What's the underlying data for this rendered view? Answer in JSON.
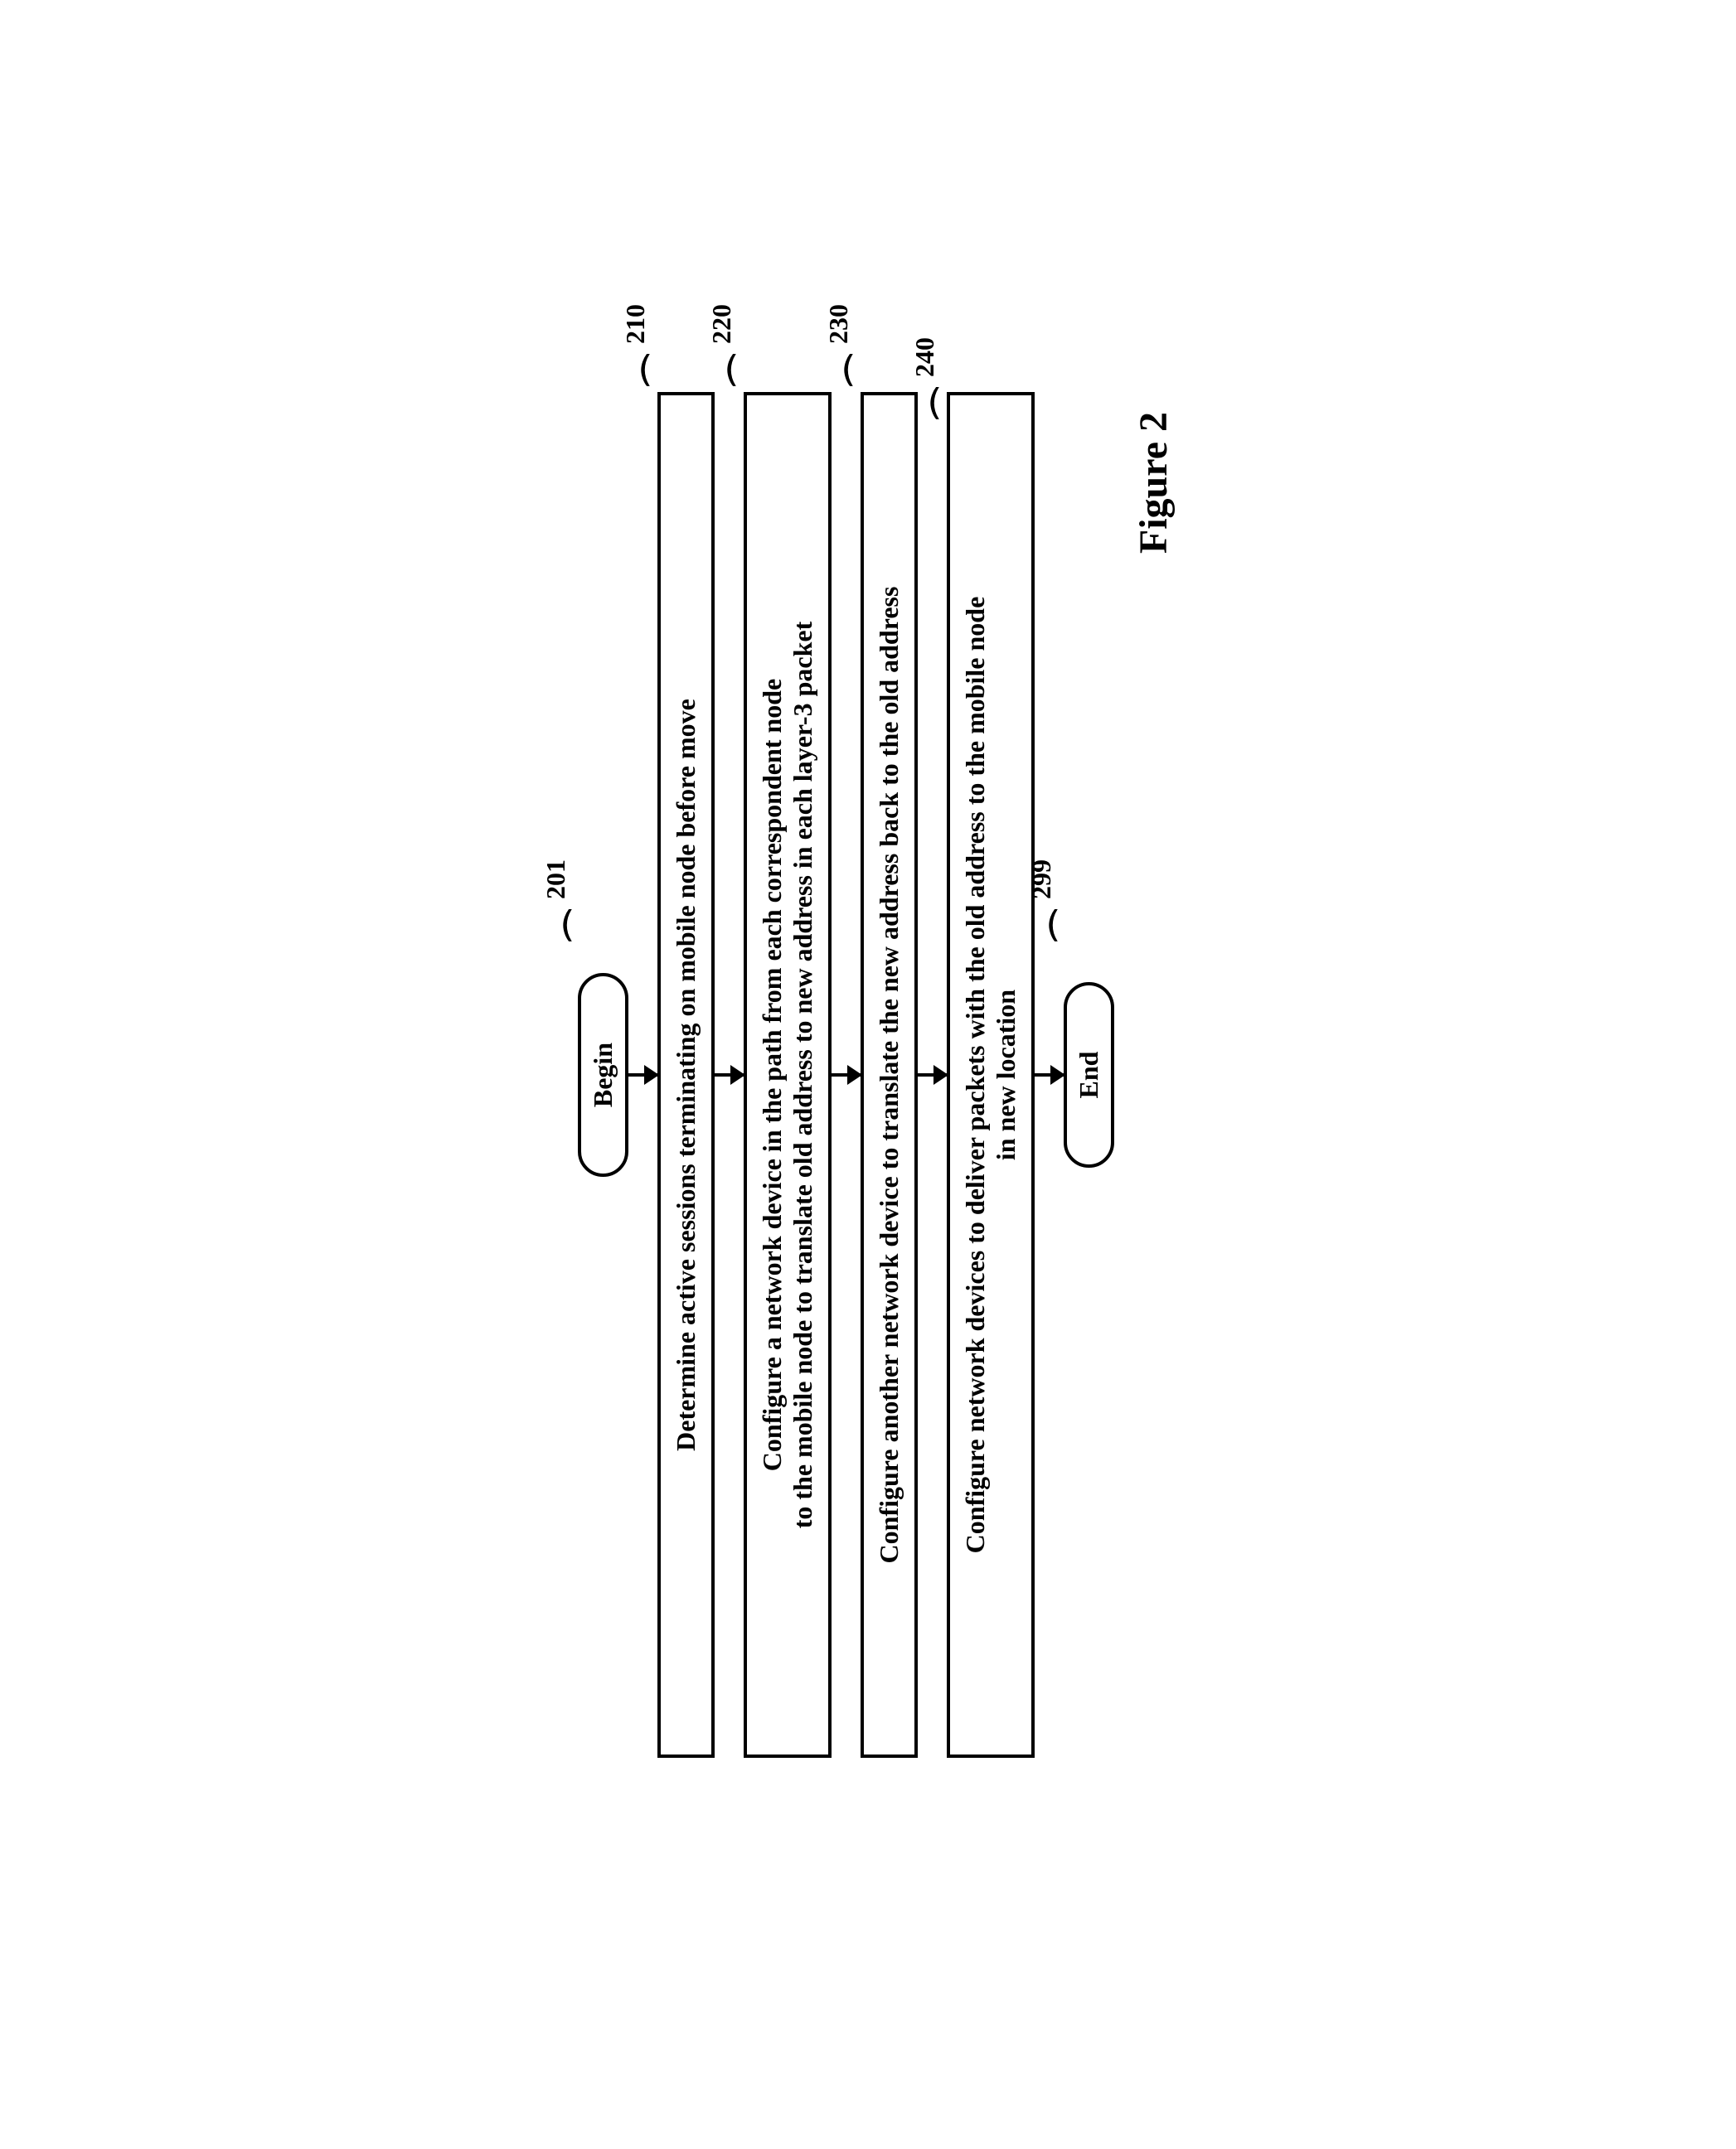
{
  "chart_data": {
    "type": "flowchart",
    "title": "Figure  2",
    "nodes": [
      {
        "id": "201",
        "type": "terminal",
        "text": "Begin"
      },
      {
        "id": "210",
        "type": "process",
        "text": "Determine active sessions terminating on mobile node before move"
      },
      {
        "id": "220",
        "type": "process",
        "text": "Configure a network device in the path from each correspondent node to the mobile node to translate old address to new address in each layer-3 packet"
      },
      {
        "id": "230",
        "type": "process",
        "text": "Configure another network device to translate the new address back to the old address"
      },
      {
        "id": "240",
        "type": "process",
        "text": "Configure network devices to deliver packets with the old address to the mobile node in new location"
      },
      {
        "id": "299",
        "type": "terminal",
        "text": "End"
      }
    ],
    "edges": [
      [
        "201",
        "210"
      ],
      [
        "210",
        "220"
      ],
      [
        "220",
        "230"
      ],
      [
        "230",
        "240"
      ],
      [
        "240",
        "299"
      ]
    ]
  },
  "labels": {
    "begin": "Begin",
    "end": "End",
    "figure": "Figure  2",
    "n201": "201",
    "n210": "210",
    "n220": "220",
    "n230": "230",
    "n240": "240",
    "n299": "299",
    "step210": "Determine active sessions terminating on mobile node before move",
    "step220": "Configure a network device in the path from each correspondent node\nto the mobile node to translate old address to new address in each layer-3 packet",
    "step230": "Configure another network device to translate the new address back to the old address",
    "step240": "Configure network devices to deliver packets with the old address to the mobile node\nin new location"
  }
}
